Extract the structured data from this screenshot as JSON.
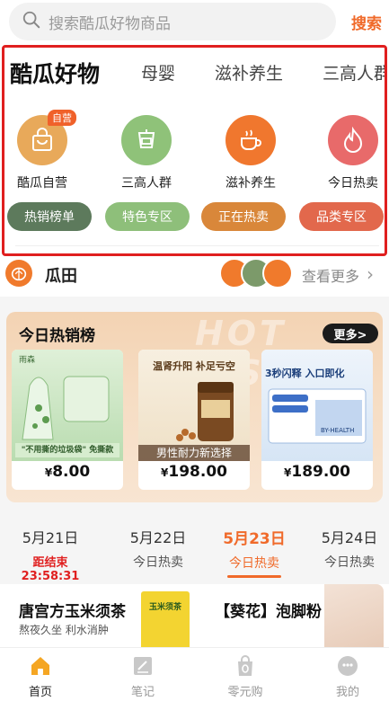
{
  "search": {
    "placeholder": "搜索酷瓜好物商品",
    "button": "搜索"
  },
  "category_tabs": [
    "酷瓜好物",
    "母婴",
    "滋补养生",
    "三高人群"
  ],
  "category_icons": [
    {
      "label": "酷瓜自营",
      "badge": "自营",
      "icon": "shopping-bag-icon",
      "color": "#e8a95a"
    },
    {
      "label": "三高人群",
      "icon": "blood-pressure-icon",
      "color": "#8fc279"
    },
    {
      "label": "滋补养生",
      "icon": "teacup-icon",
      "color": "#f0772e"
    },
    {
      "label": "今日热卖",
      "icon": "flame-icon",
      "color": "#e86a6a"
    }
  ],
  "pills": [
    {
      "label": "热销榜单",
      "color": "#5d7a5c"
    },
    {
      "label": "特色专区",
      "color": "#8ebf7a"
    },
    {
      "label": "正在热卖",
      "color": "#d9873a"
    },
    {
      "label": "品类专区",
      "color": "#e2684c"
    }
  ],
  "guatian": {
    "title": "瓜田",
    "more": "查看更多"
  },
  "hot_list": {
    "title": "今日热销榜",
    "watermark": "HOT LIST",
    "more": "更多>",
    "products": [
      {
        "price": "8.00",
        "currency": "¥",
        "brand": "雨森",
        "caption": "\"不用撕的垃圾袋\" 免撕款"
      },
      {
        "price": "198.00",
        "currency": "¥",
        "headline": "温肾升阳 补足亏空",
        "tag": "男性耐力新选择"
      },
      {
        "price": "189.00",
        "currency": "¥",
        "headline": "3秒闪释 入口即化",
        "brand": "BY-HEALTH"
      }
    ]
  },
  "dates": [
    {
      "date": "5月21日",
      "sub": "距结束23:58:31",
      "type": "countdown"
    },
    {
      "date": "5月22日",
      "sub": "今日热卖",
      "type": "normal"
    },
    {
      "date": "5月23日",
      "sub": "今日热卖",
      "type": "active"
    },
    {
      "date": "5月24日",
      "sub": "今日热卖",
      "type": "normal"
    }
  ],
  "promos": [
    {
      "title": "唐宫方玉米须茶",
      "sub": "熬夜久坐 利水消肿",
      "product_label": "玉米须茶"
    },
    {
      "title": "【葵花】泡脚粉"
    }
  ],
  "bottom_nav": [
    {
      "label": "首页",
      "icon": "home-icon",
      "active": true
    },
    {
      "label": "笔记",
      "icon": "note-icon",
      "active": false
    },
    {
      "label": "零元购",
      "icon": "zero-bag-icon",
      "active": false
    },
    {
      "label": "我的",
      "icon": "profile-icon",
      "active": false
    }
  ],
  "colors": {
    "accent": "#f06a2a",
    "highlight_border": "#e01f1f"
  }
}
